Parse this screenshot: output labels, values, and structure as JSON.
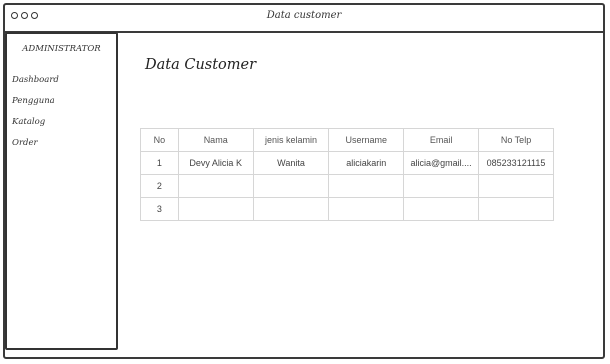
{
  "window": {
    "title": "Data customer"
  },
  "sidebar": {
    "header": "ADMINISTRATOR",
    "items": [
      {
        "label": "Dashboard"
      },
      {
        "label": "Pengguna"
      },
      {
        "label": "Katalog"
      },
      {
        "label": "Order"
      }
    ]
  },
  "main": {
    "title": "Data Customer",
    "table": {
      "headers": [
        "No",
        "Nama",
        "jenis kelamin",
        "Username",
        "Email",
        "No Telp"
      ],
      "rows": [
        [
          "1",
          "Devy Alicia K",
          "Wanita",
          "aliciakarin",
          "alicia@gmail....",
          "085233121115"
        ],
        [
          "2",
          "",
          "",
          "",
          "",
          ""
        ],
        [
          "3",
          "",
          "",
          "",
          "",
          ""
        ]
      ]
    }
  }
}
